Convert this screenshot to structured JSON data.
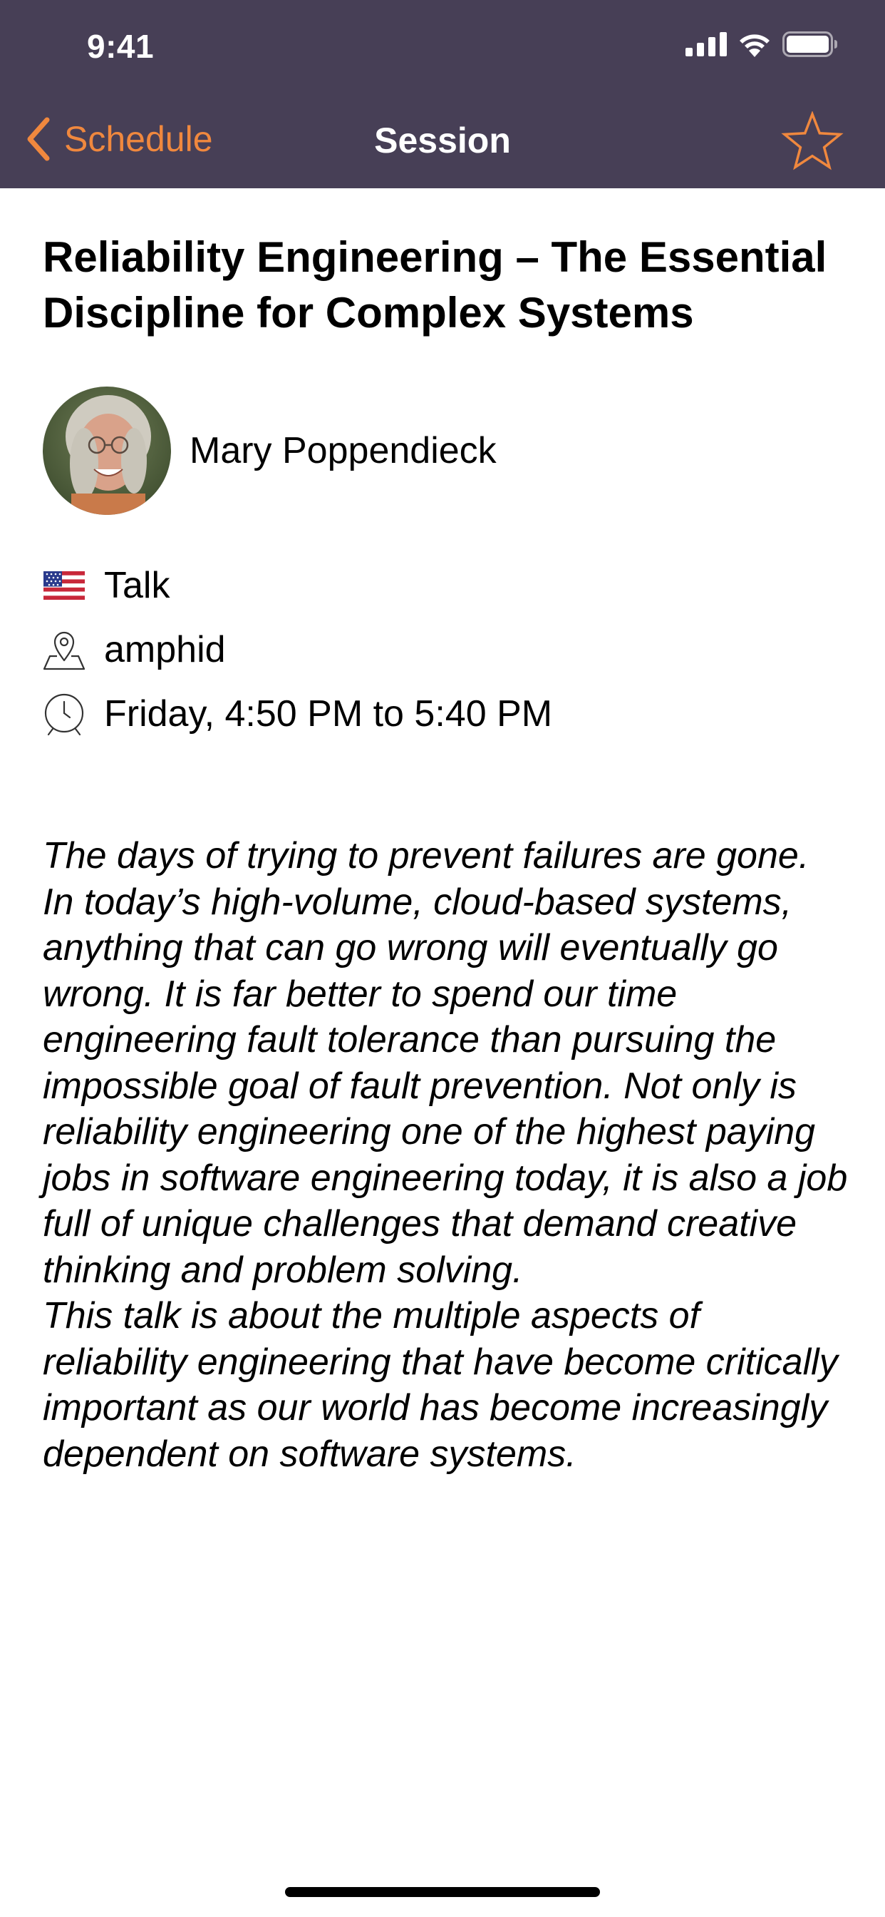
{
  "status_bar": {
    "time": "9:41",
    "icons": [
      "cellular-signal-icon",
      "wifi-icon",
      "battery-icon"
    ]
  },
  "nav": {
    "back_label": "Schedule",
    "title": "Session",
    "favorite_icon": "star-outline-icon",
    "accent_color": "#f0883e",
    "bar_color": "#473f56"
  },
  "session": {
    "title": "Reliability Engineering – The Essential Discipline for Complex Systems",
    "speaker": {
      "name": "Mary Poppendieck"
    },
    "format": {
      "icon": "us-flag-icon",
      "label": "Talk"
    },
    "room": {
      "icon": "location-pin-icon",
      "label": "amphid"
    },
    "time": {
      "icon": "clock-icon",
      "label": "Friday, 4:50 PM to 5:40 PM"
    },
    "abstract": [
      "The days of trying to prevent failures are gone. In today’s high-volume, cloud-based systems, anything that can go wrong will eventually go wrong. It is far better to spend our time engineering fault tolerance than pursuing the impossible goal of fault prevention. Not only is reliability engineering one of the highest paying jobs in software engineering today, it is also a job full of unique challenges that demand creative thinking and problem solving.",
      "This talk is about the multiple aspects of reliability engineering that have become critically important as our world has become increasingly dependent on software systems."
    ]
  }
}
